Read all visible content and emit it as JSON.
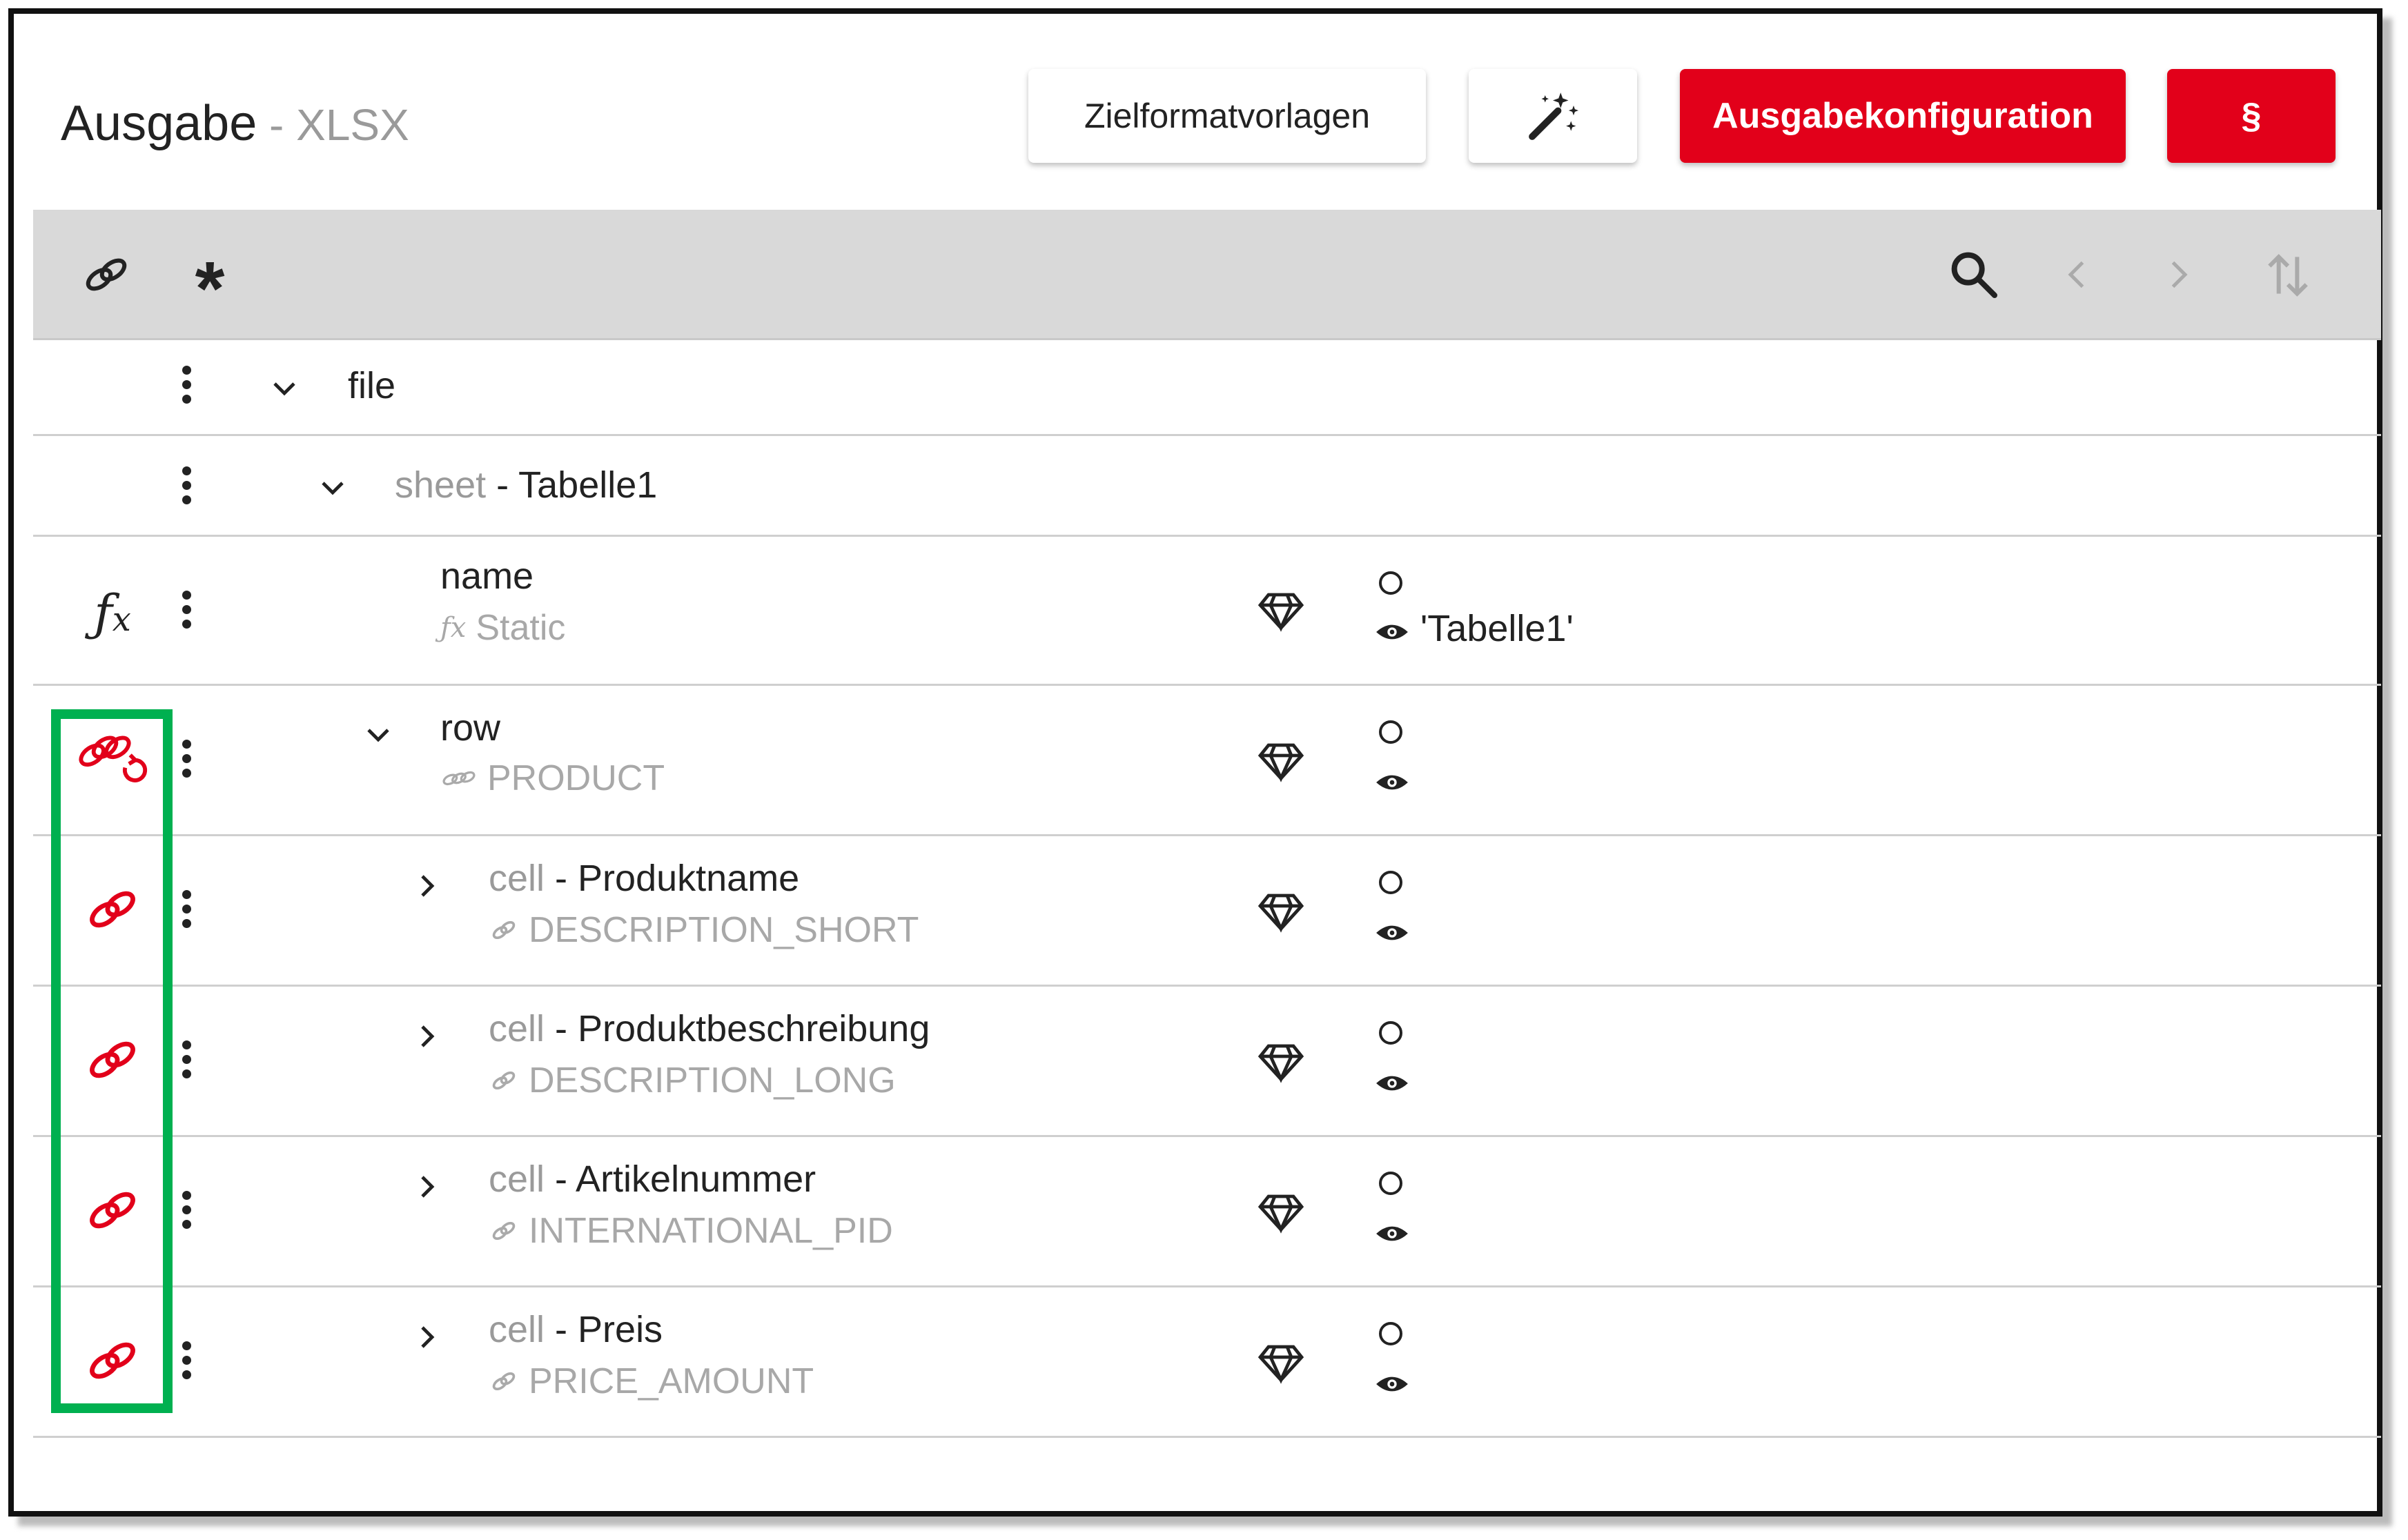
{
  "header": {
    "title": "Ausgabe",
    "subtitle": " - XLSX",
    "btn_templates": "Zielformatvorlagen",
    "btn_config": "Ausgabekonfiguration",
    "btn_paragraph": "§"
  },
  "toolbar": {
    "icons": [
      "link-icon",
      "asterisk-icon",
      "search-icon",
      "chevron-left-icon",
      "chevron-right-icon",
      "sort-icon"
    ],
    "asterisk": "*"
  },
  "tree": {
    "file": {
      "label": "file"
    },
    "sheet": {
      "type": "sheet",
      "sep": " - ",
      "name": "Tabelle1"
    },
    "name_row": {
      "label": "name",
      "source": "Static",
      "value": "'Tabelle1'"
    },
    "row_row": {
      "label": "row",
      "source": "PRODUCT"
    },
    "cells": [
      {
        "type": "cell",
        "sep": " - ",
        "name": "Produktname",
        "source": "DESCRIPTION_SHORT"
      },
      {
        "type": "cell",
        "sep": " - ",
        "name": "Produktbeschreibung",
        "source": "DESCRIPTION_LONG"
      },
      {
        "type": "cell",
        "sep": " - ",
        "name": "Artikelnummer",
        "source": "INTERNATIONAL_PID"
      },
      {
        "type": "cell",
        "sep": " - ",
        "name": "Preis",
        "source": "PRICE_AMOUNT"
      }
    ]
  },
  "colors": {
    "accent": "#e2001a",
    "highlight": "#00b050",
    "toolbar_bg": "#d9d9d9"
  }
}
